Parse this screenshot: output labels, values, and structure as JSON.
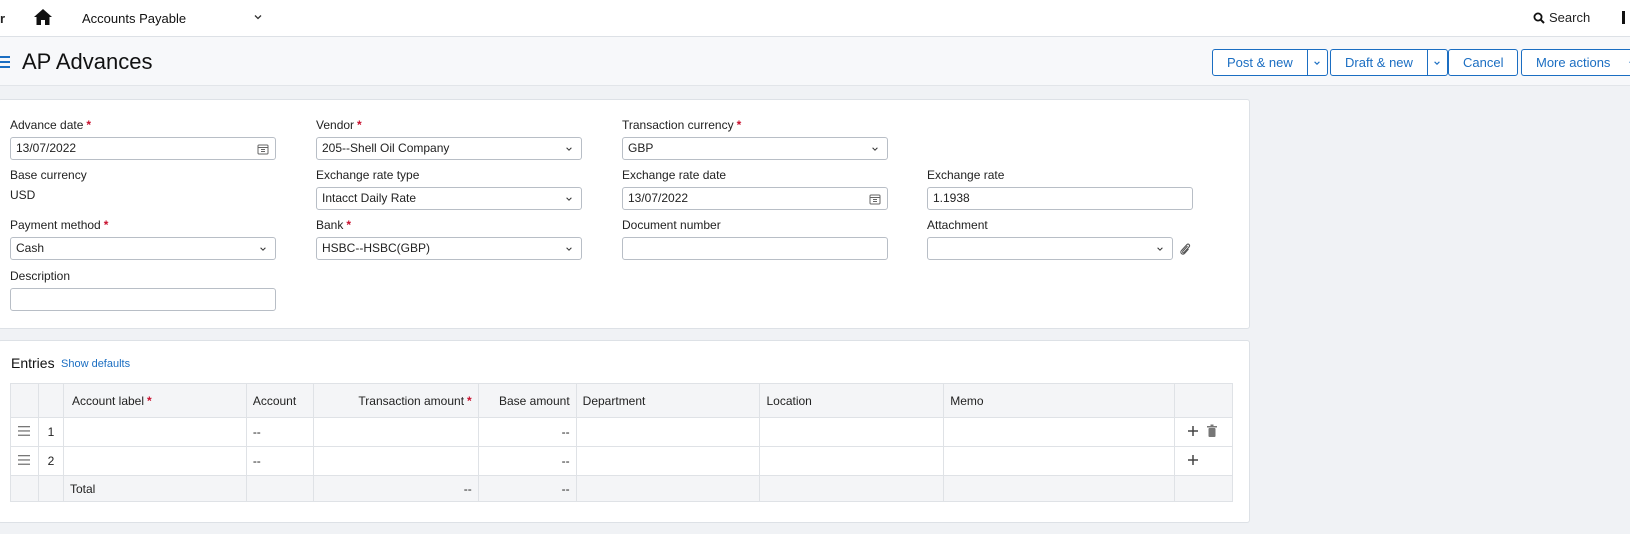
{
  "topbar": {
    "edge_left": "r",
    "module": "Accounts Payable",
    "search_label": "Search"
  },
  "page": {
    "title": "AP Advances",
    "buttons": {
      "post_new": "Post & new",
      "draft_new": "Draft & new",
      "cancel": "Cancel",
      "more_actions": "More actions"
    }
  },
  "form": {
    "advance_date": {
      "label": "Advance date",
      "value": "13/07/2022"
    },
    "vendor": {
      "label": "Vendor",
      "value": "205--Shell Oil Company"
    },
    "transaction_currency": {
      "label": "Transaction currency",
      "value": "GBP"
    },
    "base_currency": {
      "label": "Base currency",
      "value": "USD"
    },
    "exchange_rate_type": {
      "label": "Exchange rate type",
      "value": "Intacct Daily Rate"
    },
    "exchange_rate_date": {
      "label": "Exchange rate date",
      "value": "13/07/2022"
    },
    "exchange_rate": {
      "label": "Exchange rate",
      "value": "1.1938"
    },
    "payment_method": {
      "label": "Payment method",
      "value": "Cash"
    },
    "bank": {
      "label": "Bank",
      "value": "HSBC--HSBC(GBP)"
    },
    "document_number": {
      "label": "Document number",
      "value": ""
    },
    "attachment": {
      "label": "Attachment",
      "value": ""
    },
    "description": {
      "label": "Description",
      "value": ""
    },
    "required_marker": "*"
  },
  "entries": {
    "title": "Entries",
    "show_defaults": "Show defaults",
    "columns": {
      "account_label": "Account label",
      "account": "Account",
      "transaction_amount": "Transaction amount",
      "base_amount": "Base amount",
      "department": "Department",
      "location": "Location",
      "memo": "Memo"
    },
    "rows": [
      {
        "num": "1",
        "account": "--",
        "base_amount": "--"
      },
      {
        "num": "2",
        "account": "--",
        "base_amount": "--"
      }
    ],
    "total": {
      "label": "Total",
      "transaction_amount": "--",
      "base_amount": "--"
    }
  },
  "colors": {
    "accent": "#1b6ec2",
    "required": "#c8102e"
  }
}
